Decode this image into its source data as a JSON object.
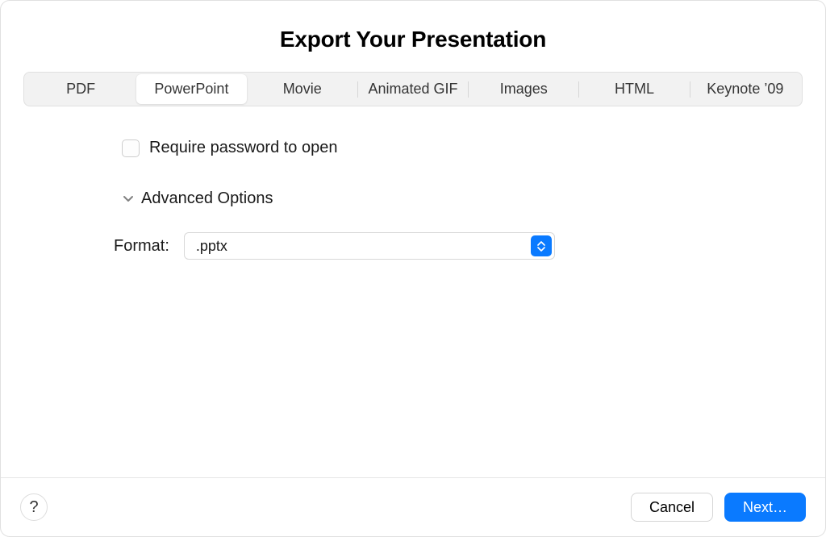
{
  "title": "Export Your Presentation",
  "tabs": [
    {
      "label": "PDF",
      "active": false
    },
    {
      "label": "PowerPoint",
      "active": true
    },
    {
      "label": "Movie",
      "active": false
    },
    {
      "label": "Animated GIF",
      "active": false
    },
    {
      "label": "Images",
      "active": false
    },
    {
      "label": "HTML",
      "active": false
    },
    {
      "label": "Keynote ’09",
      "active": false
    }
  ],
  "checkbox": {
    "require_password_label": "Require password to open",
    "require_password_checked": false
  },
  "disclosure": {
    "advanced_options_label": "Advanced Options",
    "expanded": true
  },
  "format": {
    "label": "Format:",
    "selected": ".pptx"
  },
  "footer": {
    "help_label": "?",
    "cancel_label": "Cancel",
    "next_label": "Next…"
  }
}
